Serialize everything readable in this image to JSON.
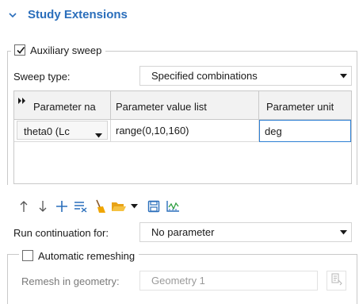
{
  "section": {
    "title": "Study Extensions"
  },
  "auxiliary_sweep": {
    "label": "Auxiliary sweep",
    "checked": true
  },
  "sweep_type": {
    "label": "Sweep type:",
    "value": "Specified combinations"
  },
  "table": {
    "headers": [
      "Parameter na",
      "Parameter value list",
      "Parameter unit"
    ],
    "rows": [
      {
        "parameter": "theta0 (Lc",
        "value_list": "range(0,10,160)",
        "unit": "deg"
      }
    ]
  },
  "toolbar": {
    "icons": [
      "move-up-icon",
      "move-down-icon",
      "add-icon",
      "delete-icon",
      "clear-icon",
      "load-from-file-icon",
      "dropdown-arrow-icon",
      "save-icon",
      "plot-icon"
    ]
  },
  "run_continuation": {
    "label": "Run continuation for:",
    "value": "No parameter"
  },
  "automatic_remeshing": {
    "label": "Automatic remeshing",
    "checked": false
  },
  "remesh": {
    "label": "Remesh in geometry:",
    "value": "Geometry 1"
  },
  "colors": {
    "accent": "#2a6ebb",
    "selected_border": "#2d7fd3",
    "disabled_text": "#9a9a9a",
    "header_bg": "#f2f2f2",
    "border": "#c9c9c9"
  }
}
